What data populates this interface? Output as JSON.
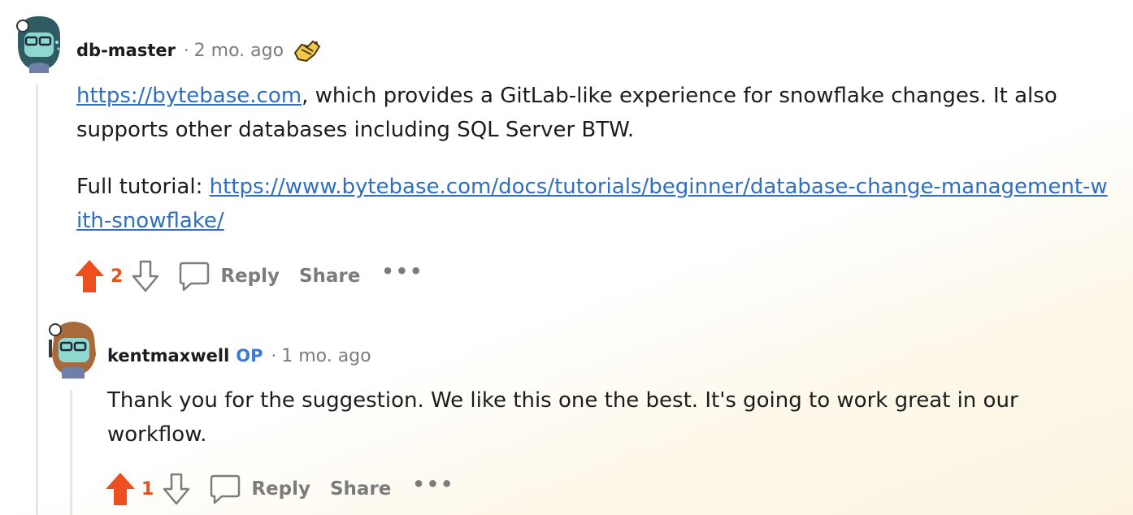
{
  "comment1": {
    "username": "db-master",
    "separator": "·",
    "time": "2 mo. ago",
    "award_icon": "helping-hand-award-icon",
    "link1": "https://bytebase.com",
    "text1": ", which provides a GitLab-like experience for snowflake changes. It also supports other databases including SQL Server BTW.",
    "text2_prefix": "Full tutorial: ",
    "link2": "https://www.bytebase.com/docs/tutorials/beginner/database-change-management-with-snowflake/",
    "score": "2",
    "reply_label": "Reply",
    "share_label": "Share",
    "more_label": "•••"
  },
  "comment2": {
    "username": "kentmaxwell",
    "op_badge": "OP",
    "separator": "·",
    "time": "1 mo. ago",
    "text": "Thank you for the suggestion. We like this one the best. It's going to work great in our workflow.",
    "score": "1",
    "reply_label": "Reply",
    "share_label": "Share",
    "more_label": "•••"
  },
  "colors": {
    "upvote": "#ed4f1f",
    "link": "#2f6fbf",
    "op": "#3a7bd5",
    "muted": "#7c7c7c"
  }
}
